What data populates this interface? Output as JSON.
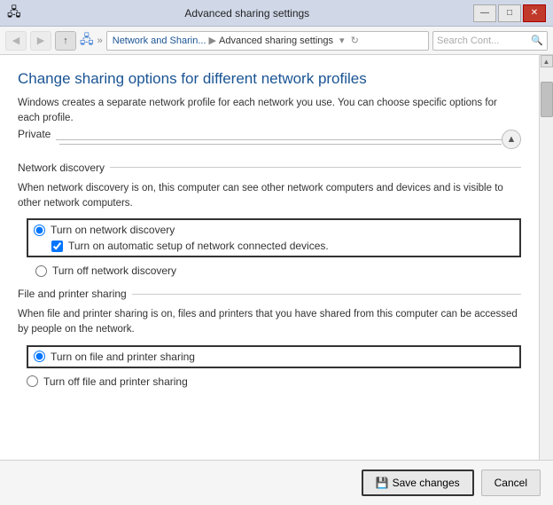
{
  "titleBar": {
    "icon": "🖧",
    "title": "Advanced sharing settings",
    "minimize": "—",
    "maximize": "□",
    "close": "✕"
  },
  "addressBar": {
    "back": "◀",
    "forward": "▶",
    "up": "↑",
    "breadcrumbs": [
      "Network and Sharin...",
      "Advanced sharing settings"
    ],
    "dropdownArrow": "▾",
    "refresh": "↻",
    "searchPlaceholder": "Search Cont...",
    "searchIcon": "🔍"
  },
  "page": {
    "title": "Change sharing options for different network profiles",
    "subtitle": "Windows creates a separate network profile for each network you use. You can choose specific options for each profile."
  },
  "privateSection": {
    "label": "Private",
    "collapseIcon": "▲",
    "networkDiscovery": {
      "label": "Network discovery",
      "description": "When network discovery is on, this computer can see other network computers and devices and is visible to other network computers.",
      "options": [
        {
          "id": "nd-on",
          "label": "Turn on network discovery",
          "checked": true
        },
        {
          "id": "nd-auto",
          "label": "Turn on automatic setup of network connected devices.",
          "type": "checkbox",
          "checked": true
        },
        {
          "id": "nd-off",
          "label": "Turn off network discovery",
          "checked": false
        }
      ]
    },
    "filePrinterSharing": {
      "label": "File and printer sharing",
      "description": "When file and printer sharing is on, files and printers that you have shared from this computer can be accessed by people on the network.",
      "options": [
        {
          "id": "fps-on",
          "label": "Turn on file and printer sharing",
          "checked": true
        },
        {
          "id": "fps-off",
          "label": "Turn off file and printer sharing",
          "checked": false
        }
      ]
    }
  },
  "footer": {
    "saveLabel": "Save changes",
    "cancelLabel": "Cancel",
    "saveIcon": "💾"
  }
}
